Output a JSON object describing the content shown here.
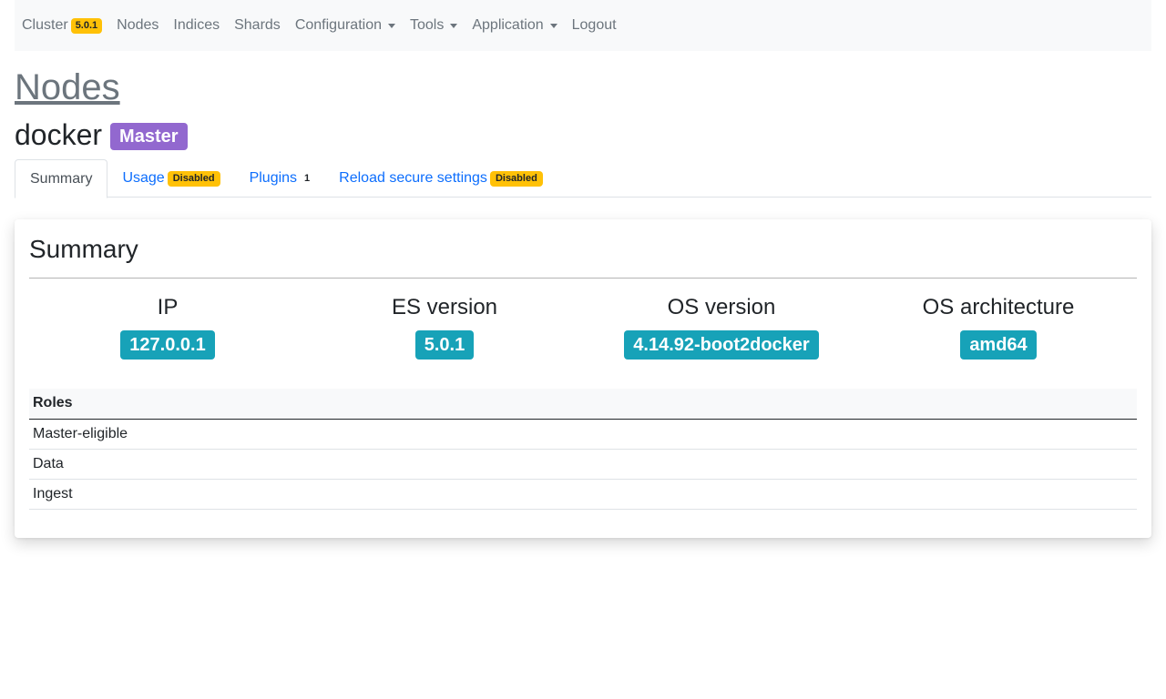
{
  "navbar": {
    "cluster_label": "Cluster",
    "cluster_version": "5.0.1",
    "items": [
      "Nodes",
      "Indices",
      "Shards"
    ],
    "dropdowns": [
      "Configuration",
      "Tools",
      "Application"
    ],
    "logout": "Logout"
  },
  "page": {
    "title": "Nodes"
  },
  "node": {
    "name": "docker",
    "role_badge": "Master"
  },
  "tabs": [
    {
      "label": "Summary",
      "active": true
    },
    {
      "label": "Usage",
      "badge": "Disabled"
    },
    {
      "label": "Plugins",
      "count": "1"
    },
    {
      "label": "Reload secure settings",
      "badge": "Disabled"
    }
  ],
  "summary": {
    "title": "Summary",
    "stats": [
      {
        "label": "IP",
        "value": "127.0.0.1"
      },
      {
        "label": "ES version",
        "value": "5.0.1"
      },
      {
        "label": "OS version",
        "value": "4.14.92-boot2docker"
      },
      {
        "label": "OS architecture",
        "value": "amd64"
      }
    ],
    "roles_header": "Roles",
    "roles": [
      "Master-eligible",
      "Data",
      "Ingest"
    ]
  },
  "colors": {
    "warning": "#ffc107",
    "master_badge": "#9268cf",
    "info": "#17a2b8",
    "link": "#0d6efd"
  }
}
